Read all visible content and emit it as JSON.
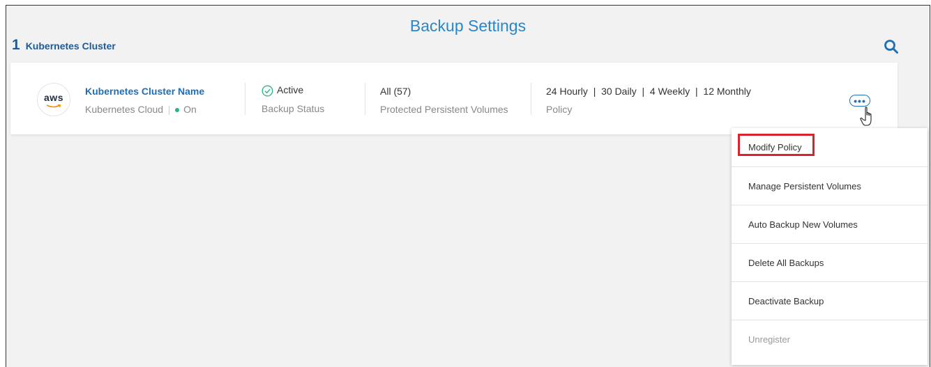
{
  "page": {
    "title": "Backup Settings",
    "cluster_count": "1",
    "cluster_count_label": "Kubernetes Cluster"
  },
  "cluster": {
    "logo_text": "aws",
    "name": "Kubernetes Cluster Name",
    "cloud": "Kubernetes Cloud",
    "state": "On",
    "backup_state": "Active",
    "backup_state_label": "Backup Status",
    "volumes": "All (57)",
    "volumes_label": "Protected Persistent Volumes",
    "policy": "24 Hourly  |  30 Daily  |  4 Weekly  |  12 Monthly",
    "policy_label": "Policy"
  },
  "menu": {
    "items": [
      "Modify Policy",
      "Manage Persistent Volumes",
      "Auto Backup New Volumes",
      "Delete All Backups",
      "Deactivate Backup",
      "Unregister"
    ]
  },
  "colors": {
    "accent": "#2a86c9",
    "link": "#1e6fb7",
    "status_green": "#24b581",
    "highlight": "#d9232e"
  },
  "icons": [
    "search-icon",
    "check-circle-icon",
    "more-options-icon",
    "hand-cursor-icon",
    "aws-logo"
  ]
}
